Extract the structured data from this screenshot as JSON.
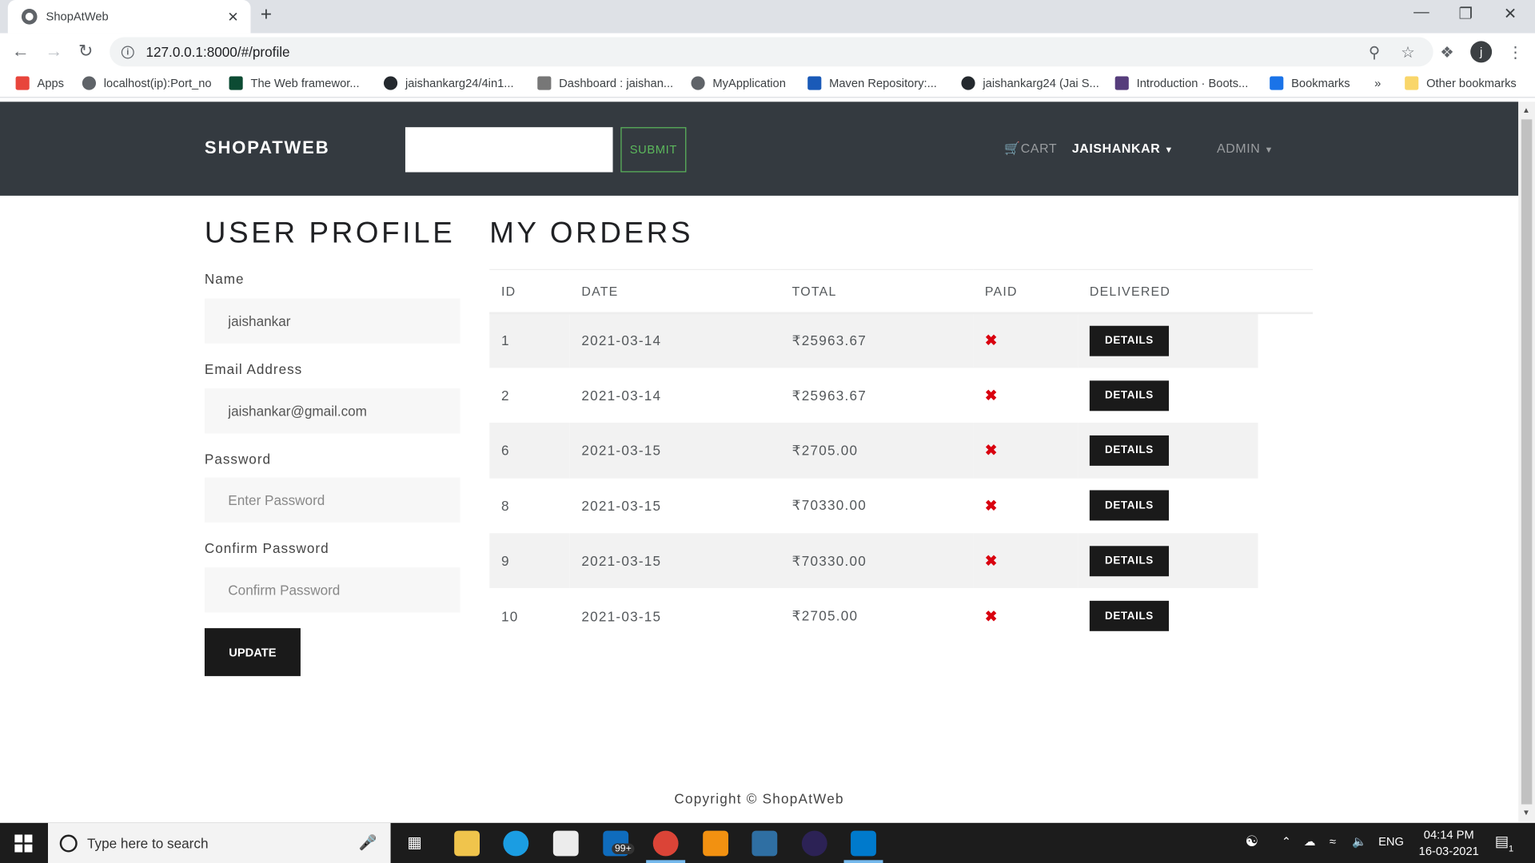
{
  "browser": {
    "tab_title": "ShopAtWeb",
    "tab_close": "✕",
    "new_tab": "+",
    "url": "127.0.0.1:8000/#/profile",
    "avatar_letter": "j",
    "bookmarks": [
      {
        "label": "Apps",
        "icon_color": "#e8453c"
      },
      {
        "label": "localhost(ip):Port_no",
        "icon_color": "#5f6368"
      },
      {
        "label": "The Web framewor...",
        "icon_color": "#0c4b33"
      },
      {
        "label": "jaishankarg24/4in1...",
        "icon_color": "#24292e"
      },
      {
        "label": "Dashboard : jaishan...",
        "icon_color": "#777777"
      },
      {
        "label": "MyApplication",
        "icon_color": "#5f6368"
      },
      {
        "label": "Maven Repository:...",
        "icon_color": "#1a5ab8"
      },
      {
        "label": "jaishankarg24 (Jai S...",
        "icon_color": "#24292e"
      },
      {
        "label": "Introduction · Boots...",
        "icon_color": "#563d7c"
      },
      {
        "label": "Bookmarks",
        "icon_color": "#1a73e8"
      }
    ],
    "bookmarks_overflow": "»",
    "other_bookmarks": "Other bookmarks"
  },
  "navbar": {
    "brand": "SHOPATWEB",
    "submit_label": "SUBMIT",
    "cart_label": "CART",
    "user_label": "JAISHANKAR",
    "admin_label": "ADMIN",
    "accent_color": "#5cb85c"
  },
  "profile": {
    "heading": "USER PROFILE",
    "name_label": "Name",
    "name_value": "jaishankar",
    "email_label": "Email Address",
    "email_value": "jaishankar@gmail.com",
    "password_label": "Password",
    "password_placeholder": "Enter Password",
    "confirm_label": "Confirm Password",
    "confirm_placeholder": "Confirm Password",
    "update_label": "UPDATE"
  },
  "orders": {
    "heading": "MY ORDERS",
    "columns": [
      "ID",
      "DATE",
      "TOTAL",
      "PAID",
      "DELIVERED"
    ],
    "paid_icon": "✖",
    "paid_color": "#d9000f",
    "details_label": "DETAILS",
    "rows": [
      {
        "id": "1",
        "date": "2021-03-14",
        "total": "₹25963.67"
      },
      {
        "id": "2",
        "date": "2021-03-14",
        "total": "₹25963.67"
      },
      {
        "id": "6",
        "date": "2021-03-15",
        "total": "₹2705.00"
      },
      {
        "id": "8",
        "date": "2021-03-15",
        "total": "₹70330.00"
      },
      {
        "id": "9",
        "date": "2021-03-15",
        "total": "₹70330.00"
      },
      {
        "id": "10",
        "date": "2021-03-15",
        "total": "₹2705.00"
      }
    ]
  },
  "footer": {
    "text": "Copyright © ShopAtWeb"
  },
  "taskbar": {
    "search_placeholder": "Type here to search",
    "mail_badge": "99+",
    "language": "ENG",
    "time": "04:14 PM",
    "date": "16-03-2021",
    "notification_count": "1"
  }
}
